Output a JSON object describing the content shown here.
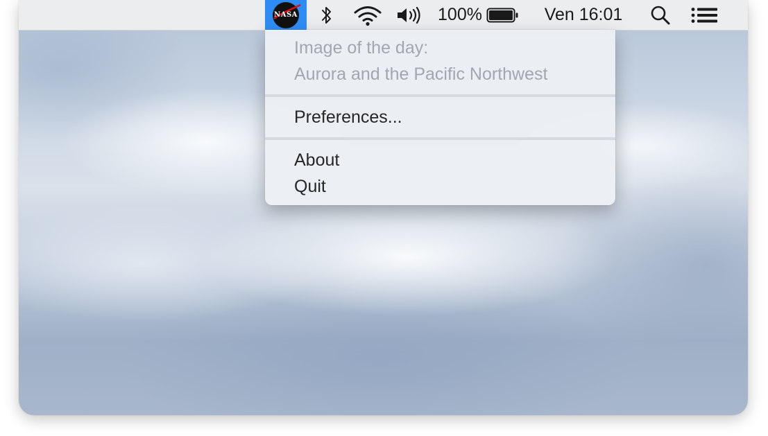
{
  "menubar": {
    "app_icon_label": "NASA",
    "battery_percent": "100%",
    "clock": "Ven 16:01",
    "icons": [
      "nasa-icon",
      "bluetooth-icon",
      "wifi-icon",
      "volume-icon",
      "battery-icon",
      "spotlight-search-icon",
      "notification-center-icon"
    ],
    "active_color": "#2e8df5",
    "battery_level": 1.0
  },
  "menu": {
    "header_line1": "Image of the day:",
    "header_line2": "Aurora and the Pacific Northwest",
    "preferences": "Preferences...",
    "about": "About",
    "quit": "Quit"
  }
}
